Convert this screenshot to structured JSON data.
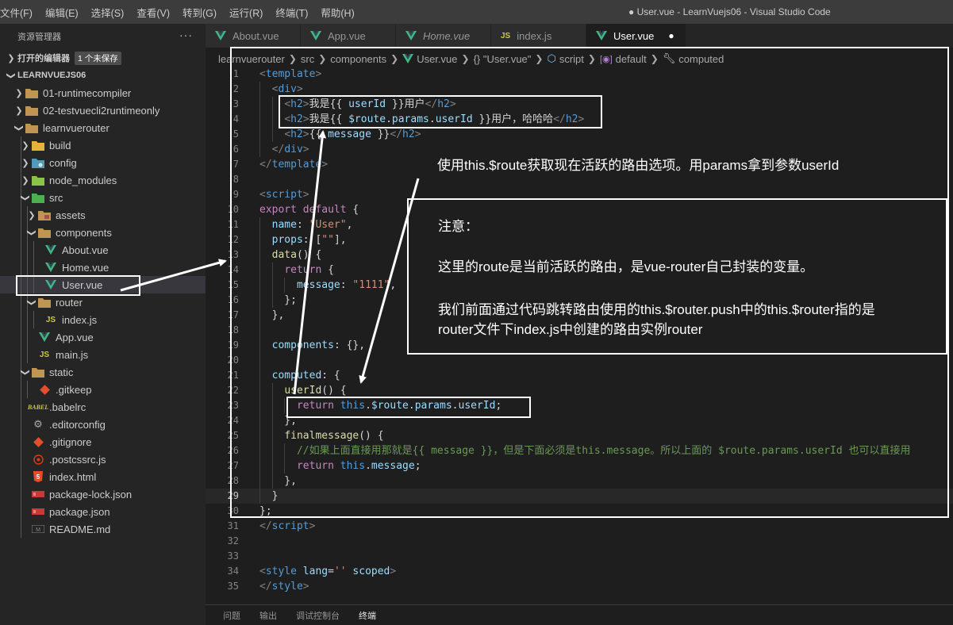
{
  "menu": [
    "文件(F)",
    "编辑(E)",
    "选择(S)",
    "查看(V)",
    "转到(G)",
    "运行(R)",
    "终端(T)",
    "帮助(H)"
  ],
  "window_title": "● User.vue - LearnVuejs06 - Visual Studio Code",
  "explorer": {
    "title": "资源管理器",
    "more": "···",
    "open_editors": "打开的编辑器",
    "unsaved_badge": "1 个未保存",
    "root": "LEARNVUEJS06",
    "items": [
      {
        "label": "01-runtimecompiler",
        "icon": "folder-icon",
        "indent": 1,
        "twisty": "right"
      },
      {
        "label": "02-testvuecli2runtimeonly",
        "icon": "folder-icon",
        "indent": 1,
        "twisty": "right"
      },
      {
        "label": "learnvuerouter",
        "icon": "folder-open-icon",
        "indent": 1,
        "twisty": "down"
      },
      {
        "label": "build",
        "icon": "folder-build-icon",
        "indent": 2,
        "twisty": "right"
      },
      {
        "label": "config",
        "icon": "folder-config-icon",
        "indent": 2,
        "twisty": "right"
      },
      {
        "label": "node_modules",
        "icon": "folder-node-icon",
        "indent": 2,
        "twisty": "right"
      },
      {
        "label": "src",
        "icon": "folder-src-icon",
        "indent": 2,
        "twisty": "down"
      },
      {
        "label": "assets",
        "icon": "folder-assets-icon",
        "indent": 3,
        "twisty": "right"
      },
      {
        "label": "components",
        "icon": "folder-open-icon",
        "indent": 3,
        "twisty": "down"
      },
      {
        "label": "About.vue",
        "icon": "vue-icon",
        "indent": 4,
        "twisty": ""
      },
      {
        "label": "Home.vue",
        "icon": "vue-icon",
        "indent": 4,
        "twisty": ""
      },
      {
        "label": "User.vue",
        "icon": "vue-icon",
        "indent": 4,
        "twisty": "",
        "selected": true
      },
      {
        "label": "router",
        "icon": "folder-open-icon",
        "indent": 3,
        "twisty": "down"
      },
      {
        "label": "index.js",
        "icon": "js-icon",
        "indent": 4,
        "twisty": ""
      },
      {
        "label": "App.vue",
        "icon": "vue-icon",
        "indent": 3,
        "twisty": ""
      },
      {
        "label": "main.js",
        "icon": "js-icon",
        "indent": 3,
        "twisty": ""
      },
      {
        "label": "static",
        "icon": "folder-open-icon",
        "indent": 2,
        "twisty": "down"
      },
      {
        "label": ".gitkeep",
        "icon": "git-icon",
        "indent": 3,
        "twisty": ""
      },
      {
        "label": ".babelrc",
        "icon": "babel-icon",
        "indent": 2,
        "twisty": ""
      },
      {
        "label": ".editorconfig",
        "icon": "gear-icon",
        "indent": 2,
        "twisty": ""
      },
      {
        "label": ".gitignore",
        "icon": "git-icon",
        "indent": 2,
        "twisty": ""
      },
      {
        "label": ".postcssrc.js",
        "icon": "postcss-icon",
        "indent": 2,
        "twisty": ""
      },
      {
        "label": "index.html",
        "icon": "html5-icon",
        "indent": 2,
        "twisty": ""
      },
      {
        "label": "package-lock.json",
        "icon": "npm-icon",
        "indent": 2,
        "twisty": ""
      },
      {
        "label": "package.json",
        "icon": "npm-icon",
        "indent": 2,
        "twisty": ""
      },
      {
        "label": "README.md",
        "icon": "markdown-icon",
        "indent": 2,
        "twisty": ""
      }
    ]
  },
  "tabs": [
    {
      "label": "About.vue",
      "icon": "vue-icon",
      "italic": false,
      "active": false,
      "dirty": false
    },
    {
      "label": "App.vue",
      "icon": "vue-icon",
      "italic": false,
      "active": false,
      "dirty": false
    },
    {
      "label": "Home.vue",
      "icon": "vue-icon",
      "italic": true,
      "active": false,
      "dirty": false
    },
    {
      "label": "index.js",
      "icon": "js-icon",
      "italic": false,
      "active": false,
      "dirty": false
    },
    {
      "label": "User.vue",
      "icon": "vue-icon",
      "italic": false,
      "active": true,
      "dirty": true
    }
  ],
  "breadcrumbs": [
    {
      "label": "learnvuerouter",
      "icon": ""
    },
    {
      "label": "src",
      "icon": ""
    },
    {
      "label": "components",
      "icon": ""
    },
    {
      "label": "User.vue",
      "icon": "vue-icon"
    },
    {
      "label": "{} \"User.vue\"",
      "icon": ""
    },
    {
      "label": "script",
      "icon": "cube-icon"
    },
    {
      "label": "default",
      "icon": "module-icon"
    },
    {
      "label": "computed",
      "icon": "wrench-icon"
    }
  ],
  "current_line": 29,
  "code_lines": [
    {
      "n": 1,
      "g": 0,
      "s": [
        [
          "t-br",
          "<"
        ],
        [
          "t-tag",
          "template"
        ],
        [
          "t-br",
          ">"
        ]
      ]
    },
    {
      "n": 2,
      "g": 1,
      "s": [
        [
          "t-txt",
          "  "
        ],
        [
          "t-br",
          "<"
        ],
        [
          "t-tag",
          "div"
        ],
        [
          "t-br",
          ">"
        ]
      ]
    },
    {
      "n": 3,
      "g": 2,
      "s": [
        [
          "t-txt",
          "    "
        ],
        [
          "t-br",
          "<"
        ],
        [
          "t-tag",
          "h2"
        ],
        [
          "t-br",
          ">"
        ],
        [
          "t-txt",
          "我是{{ "
        ],
        [
          "t-prop",
          "userId"
        ],
        [
          "t-txt",
          " }}用户"
        ],
        [
          "t-br",
          "</"
        ],
        [
          "t-tag",
          "h2"
        ],
        [
          "t-br",
          ">"
        ]
      ]
    },
    {
      "n": 4,
      "g": 2,
      "s": [
        [
          "t-txt",
          "    "
        ],
        [
          "t-br",
          "<"
        ],
        [
          "t-tag",
          "h2"
        ],
        [
          "t-br",
          ">"
        ],
        [
          "t-txt",
          "我是{{ "
        ],
        [
          "t-prop",
          "$route"
        ],
        [
          "t-txt",
          "."
        ],
        [
          "t-prop",
          "params"
        ],
        [
          "t-txt",
          "."
        ],
        [
          "t-prop",
          "userId"
        ],
        [
          "t-txt",
          " }}用户，哈哈哈"
        ],
        [
          "t-br",
          "</"
        ],
        [
          "t-tag",
          "h2"
        ],
        [
          "t-br",
          ">"
        ]
      ]
    },
    {
      "n": 5,
      "g": 2,
      "s": [
        [
          "t-txt",
          "    "
        ],
        [
          "t-br",
          "<"
        ],
        [
          "t-tag",
          "h2"
        ],
        [
          "t-br",
          ">"
        ],
        [
          "t-txt",
          "{{ "
        ],
        [
          "t-prop",
          "message"
        ],
        [
          "t-txt",
          " }}"
        ],
        [
          "t-br",
          "</"
        ],
        [
          "t-tag",
          "h2"
        ],
        [
          "t-br",
          ">"
        ]
      ]
    },
    {
      "n": 6,
      "g": 1,
      "s": [
        [
          "t-txt",
          "  "
        ],
        [
          "t-br",
          "</"
        ],
        [
          "t-tag",
          "div"
        ],
        [
          "t-br",
          ">"
        ]
      ]
    },
    {
      "n": 7,
      "g": 0,
      "s": [
        [
          "t-br",
          "</"
        ],
        [
          "t-tag",
          "template"
        ],
        [
          "t-br",
          ">"
        ]
      ]
    },
    {
      "n": 8,
      "g": 0,
      "s": []
    },
    {
      "n": 9,
      "g": 0,
      "s": [
        [
          "t-br",
          "<"
        ],
        [
          "t-tag",
          "script"
        ],
        [
          "t-br",
          ">"
        ]
      ]
    },
    {
      "n": 10,
      "g": 0,
      "s": [
        [
          "t-kw",
          "export"
        ],
        [
          "t-txt",
          " "
        ],
        [
          "t-kw",
          "default"
        ],
        [
          "t-txt",
          " {"
        ]
      ]
    },
    {
      "n": 11,
      "g": 1,
      "s": [
        [
          "t-txt",
          "  "
        ],
        [
          "t-prop",
          "name"
        ],
        [
          "t-txt",
          ": "
        ],
        [
          "t-str",
          "\"User\""
        ],
        [
          "t-txt",
          ","
        ]
      ]
    },
    {
      "n": 12,
      "g": 1,
      "s": [
        [
          "t-txt",
          "  "
        ],
        [
          "t-prop",
          "props"
        ],
        [
          "t-txt",
          ": ["
        ],
        [
          "t-str",
          "\"\""
        ],
        [
          "t-txt",
          "],"
        ]
      ]
    },
    {
      "n": 13,
      "g": 1,
      "s": [
        [
          "t-txt",
          "  "
        ],
        [
          "t-fn",
          "data"
        ],
        [
          "t-txt",
          "() {"
        ]
      ]
    },
    {
      "n": 14,
      "g": 2,
      "s": [
        [
          "t-txt",
          "    "
        ],
        [
          "t-kw",
          "return"
        ],
        [
          "t-txt",
          " {"
        ]
      ]
    },
    {
      "n": 15,
      "g": 3,
      "s": [
        [
          "t-txt",
          "      "
        ],
        [
          "t-prop",
          "message"
        ],
        [
          "t-txt",
          ": "
        ],
        [
          "t-str",
          "\"1111\""
        ],
        [
          "t-txt",
          ","
        ]
      ]
    },
    {
      "n": 16,
      "g": 2,
      "s": [
        [
          "t-txt",
          "    };"
        ]
      ]
    },
    {
      "n": 17,
      "g": 1,
      "s": [
        [
          "t-txt",
          "  },"
        ]
      ]
    },
    {
      "n": 18,
      "g": 1,
      "s": []
    },
    {
      "n": 19,
      "g": 1,
      "s": [
        [
          "t-txt",
          "  "
        ],
        [
          "t-prop",
          "components"
        ],
        [
          "t-txt",
          ": {},"
        ]
      ]
    },
    {
      "n": 20,
      "g": 1,
      "s": []
    },
    {
      "n": 21,
      "g": 1,
      "s": [
        [
          "t-txt",
          "  "
        ],
        [
          "t-prop",
          "computed"
        ],
        [
          "t-txt",
          ": {"
        ]
      ]
    },
    {
      "n": 22,
      "g": 2,
      "s": [
        [
          "t-txt",
          "    "
        ],
        [
          "t-fn",
          "userId"
        ],
        [
          "t-txt",
          "() {"
        ]
      ]
    },
    {
      "n": 23,
      "g": 3,
      "s": [
        [
          "t-txt",
          "      "
        ],
        [
          "t-kw",
          "return"
        ],
        [
          "t-txt",
          " "
        ],
        [
          "t-kb",
          "this"
        ],
        [
          "t-txt",
          "."
        ],
        [
          "t-prop",
          "$route"
        ],
        [
          "t-txt",
          "."
        ],
        [
          "t-prop",
          "params"
        ],
        [
          "t-txt",
          "."
        ],
        [
          "t-prop",
          "userId"
        ],
        [
          "t-txt",
          ";"
        ]
      ]
    },
    {
      "n": 24,
      "g": 2,
      "s": [
        [
          "t-txt",
          "    },"
        ]
      ]
    },
    {
      "n": 25,
      "g": 2,
      "s": [
        [
          "t-txt",
          "    "
        ],
        [
          "t-fn",
          "finalmessage"
        ],
        [
          "t-txt",
          "() {"
        ]
      ]
    },
    {
      "n": 26,
      "g": 3,
      "s": [
        [
          "t-txt",
          "      "
        ],
        [
          "t-cm",
          "//如果上面直接用那就是{{ message }}，但是下面必须是this.message。所以上面的 $route.params.userId 也可以直接用"
        ]
      ]
    },
    {
      "n": 27,
      "g": 3,
      "s": [
        [
          "t-txt",
          "      "
        ],
        [
          "t-kw",
          "return"
        ],
        [
          "t-txt",
          " "
        ],
        [
          "t-kb",
          "this"
        ],
        [
          "t-txt",
          "."
        ],
        [
          "t-prop",
          "message"
        ],
        [
          "t-txt",
          ";"
        ]
      ]
    },
    {
      "n": 28,
      "g": 2,
      "s": [
        [
          "t-txt",
          "    },"
        ]
      ]
    },
    {
      "n": 29,
      "g": 1,
      "s": [
        [
          "t-txt",
          "  }"
        ]
      ]
    },
    {
      "n": 30,
      "g": 0,
      "s": [
        [
          "t-txt",
          "};"
        ]
      ]
    },
    {
      "n": 31,
      "g": 0,
      "s": [
        [
          "t-br",
          "</"
        ],
        [
          "t-tag",
          "script"
        ],
        [
          "t-br",
          ">"
        ]
      ]
    },
    {
      "n": 32,
      "g": 0,
      "s": []
    },
    {
      "n": 33,
      "g": 0,
      "s": []
    },
    {
      "n": 34,
      "g": 0,
      "s": [
        [
          "t-br",
          "<"
        ],
        [
          "t-tag",
          "style"
        ],
        [
          "t-txt",
          " "
        ],
        [
          "t-attr",
          "lang"
        ],
        [
          "t-txt",
          "="
        ],
        [
          "t-str",
          "''"
        ],
        [
          "t-txt",
          " "
        ],
        [
          "t-attr",
          "scoped"
        ],
        [
          "t-br",
          ">"
        ]
      ]
    },
    {
      "n": 35,
      "g": 0,
      "s": [
        [
          "t-br",
          "</"
        ],
        [
          "t-tag",
          "style"
        ],
        [
          "t-br",
          ">"
        ]
      ]
    }
  ],
  "panel_tabs": [
    {
      "label": "问题",
      "active": false
    },
    {
      "label": "输出",
      "active": false
    },
    {
      "label": "调试控制台",
      "active": false
    },
    {
      "label": "终端",
      "active": true
    }
  ],
  "annotations": {
    "route_note": "使用this.$route获取现在活跃的路由选项。用params拿到参数userId",
    "note_title": "注意：",
    "note_line1": "这里的route是当前活跃的路由，是vue-router自己封装的变量。",
    "note_line2": "我们前面通过代码跳转路由使用的this.$router.push中的this.$router指的是",
    "note_line3": "router文件下index.js中创建的路由实例router"
  },
  "colors": {
    "vue": "#41b883",
    "js": "#cbcb41",
    "folder": "#c09553",
    "annotation": "#ffffff"
  }
}
